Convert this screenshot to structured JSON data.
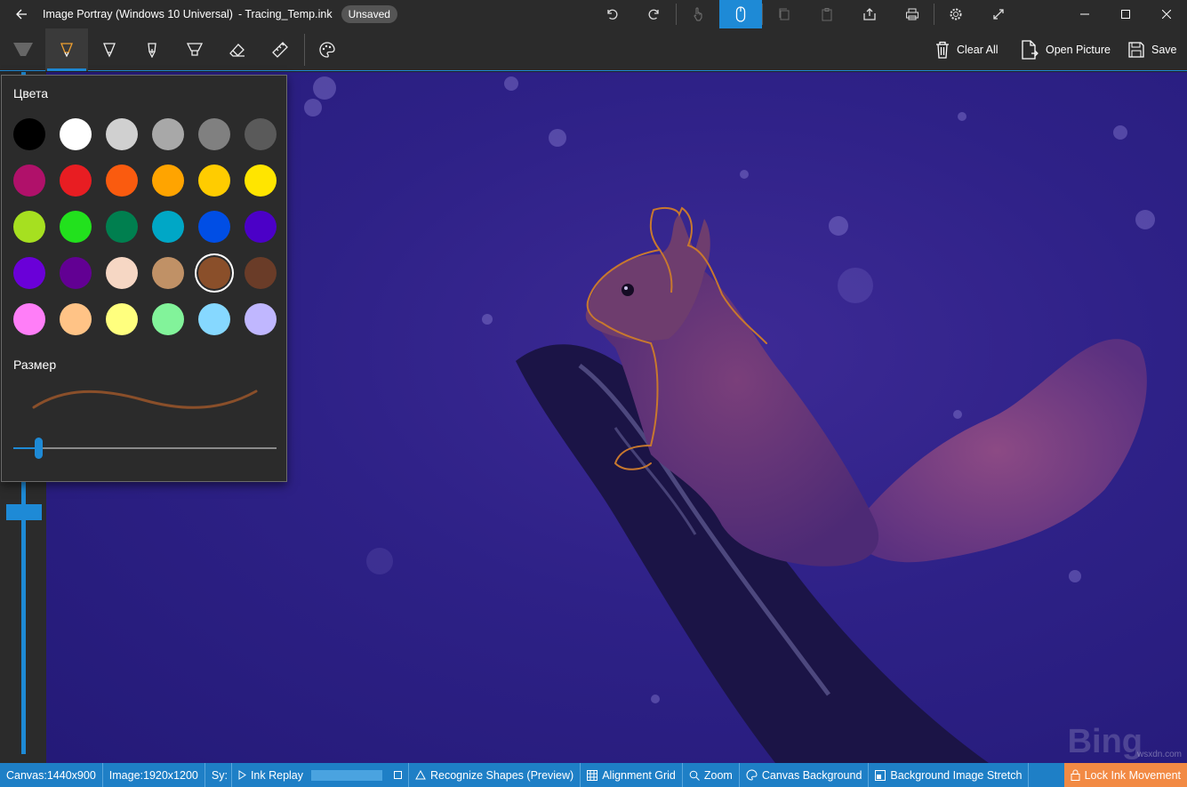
{
  "titlebar": {
    "app_title": "Image Portray (Windows 10 Universal)",
    "file_name": "- Tracing_Temp.ink",
    "badge": "Unsaved"
  },
  "toolbar": {
    "clear_all": "Clear All",
    "open_picture": "Open Picture",
    "save": "Save"
  },
  "flyout": {
    "colors_title": "Цвета",
    "size_title": "Размер",
    "selected_color": "#8a4f2a",
    "size_value": 0.1,
    "colors": [
      "#000000",
      "#ffffff",
      "#d0d0d0",
      "#a8a8a8",
      "#808080",
      "#5a5a5a",
      "#b0116a",
      "#e81d22",
      "#fa5b0f",
      "#ffa400",
      "#ffcc00",
      "#ffe500",
      "#a6e020",
      "#22e11d",
      "#007f4f",
      "#00a7c6",
      "#004ee5",
      "#4b00c7",
      "#6a00d8",
      "#620093",
      "#f6d7c4",
      "#c09166",
      "#8a4f2a",
      "#6a3c28",
      "#ff7ef8",
      "#ffc386",
      "#ffff7e",
      "#82f39a",
      "#86d8ff",
      "#c0b7ff"
    ]
  },
  "statusbar": {
    "canvas": "Canvas:1440x900",
    "image": "Image:1920x1200",
    "sys": "Sy:",
    "ink_replay": "Ink Replay",
    "recognize_shapes": "Recognize Shapes (Preview)",
    "alignment_grid": "Alignment Grid",
    "zoom": "Zoom",
    "canvas_background": "Canvas Background",
    "background_image_stretch": "Background Image Stretch",
    "lock_ink_movement": "Lock Ink Movement"
  },
  "canvas": {
    "watermark": "Bing",
    "watermark_small": "wsxdn.com"
  },
  "colors": {
    "accent": "#1e8ad6",
    "ink": "#c8782e",
    "lock": "#f28a44"
  }
}
